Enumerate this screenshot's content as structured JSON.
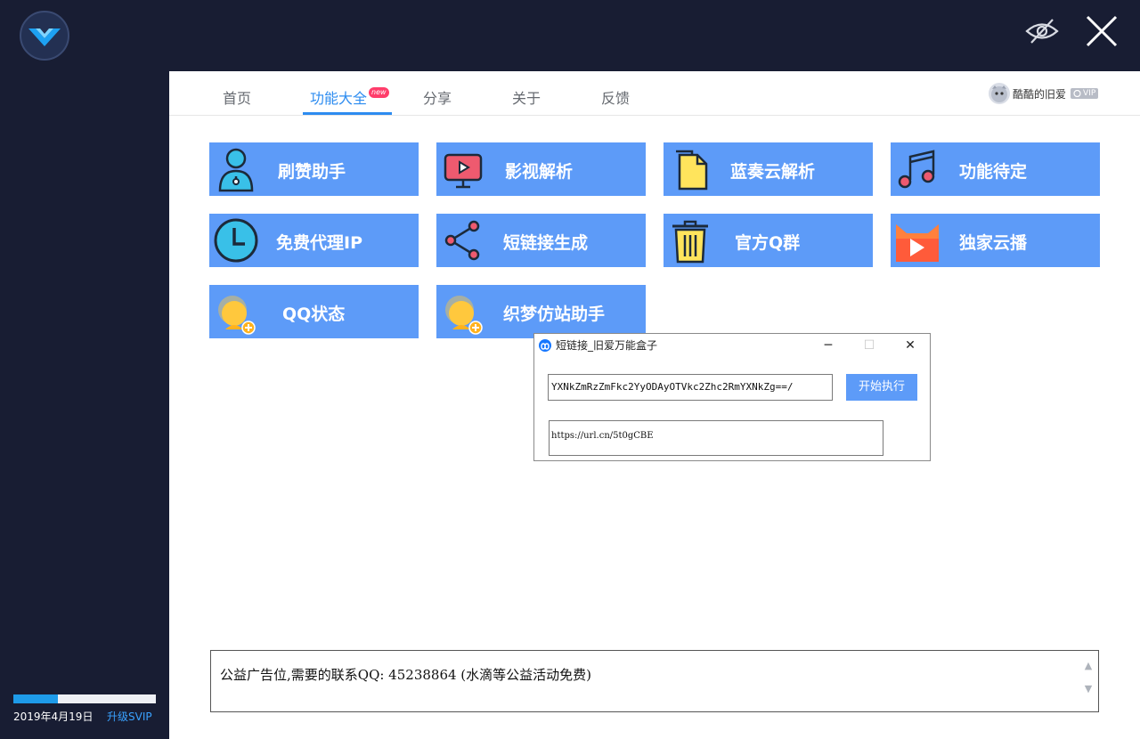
{
  "topbar": {
    "hide_icon": "eye-slash-icon",
    "close_icon": "close-icon"
  },
  "sidebar": {
    "progress": 0.31,
    "date": "2019年4月19日",
    "upgrade_label": "升级SVIP"
  },
  "tabs": [
    {
      "label": "首页"
    },
    {
      "label": "功能大全",
      "badge": "new",
      "active": true
    },
    {
      "label": "分享"
    },
    {
      "label": "关于"
    },
    {
      "label": "反馈"
    }
  ],
  "user": {
    "name": "酷酷的旧爱",
    "badge": "VIP"
  },
  "features": [
    {
      "label": "刷赞助手",
      "icon": "user-icon"
    },
    {
      "label": "影视解析",
      "icon": "video-play-icon"
    },
    {
      "label": "蓝奏云解析",
      "icon": "document-icon"
    },
    {
      "label": "功能待定",
      "icon": "music-note-icon"
    },
    {
      "label": "免费代理IP",
      "icon": "clock-icon"
    },
    {
      "label": "短链接生成",
      "icon": "share-icon"
    },
    {
      "label": "官方Q群",
      "icon": "trash-icon"
    },
    {
      "label": "独家云播",
      "icon": "cloud-play-icon"
    },
    {
      "label": "QQ状态",
      "icon": "qq-status-icon"
    },
    {
      "label": "织梦仿站助手",
      "icon": "qq-status-icon"
    }
  ],
  "ad": {
    "text": "公益广告位,需要的联系QQ: 45238864 (水滴等公益活动免费)"
  },
  "dialog": {
    "title": "短链接_旧爱万能盒子",
    "minimize": "─",
    "maximize": "☐",
    "close": "✕",
    "input_value": "YXNkZmRzZmFkc2YyODAyOTVkc2Zhc2RmYXNkZg==/",
    "run_label": "开始执行",
    "result": "https://url.cn/5t0gCBE"
  },
  "colors": {
    "accent": "#2d8cf0",
    "tile": "#5d9bf8",
    "dark": "#181d33"
  }
}
